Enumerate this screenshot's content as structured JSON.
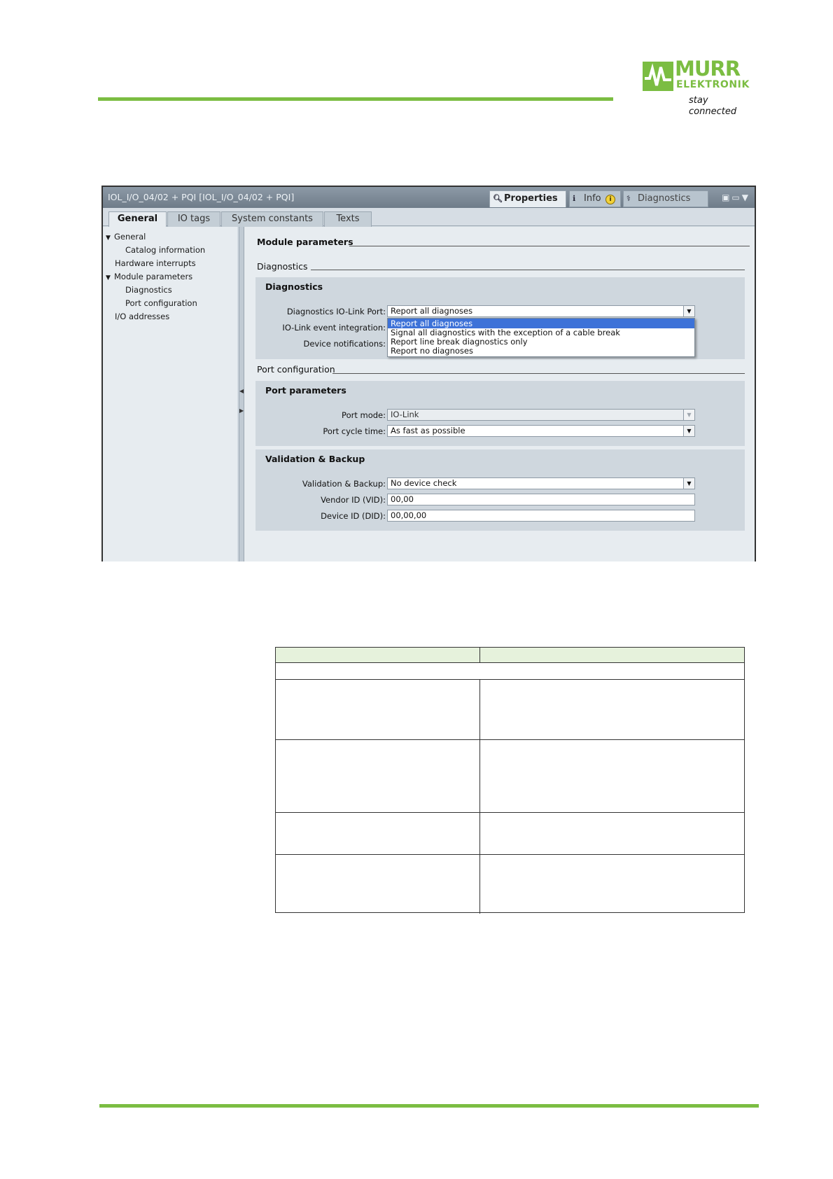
{
  "brand": {
    "name": "MURR",
    "subname": "ELEKTRONIK",
    "tagline": "stay connected",
    "color": "#7bbd42"
  },
  "window": {
    "title": "IOL_I/O_04/02 + PQI [IOL_I/O_04/02 + PQI]",
    "right_tabs": {
      "properties": "Properties",
      "info": "Info",
      "info_badge": "i",
      "diagnostics": "Diagnostics"
    },
    "tabs": [
      "General",
      "IO tags",
      "System constants",
      "Texts"
    ]
  },
  "tree": {
    "items": [
      "General",
      "Catalog information",
      "Hardware interrupts",
      "Module parameters",
      "Diagnostics",
      "Port configuration",
      "I/O addresses"
    ],
    "selected": "Module parameters"
  },
  "content": {
    "heading": "Module parameters",
    "diag_section": "Diagnostics",
    "diag_group": {
      "title": "Diagnostics",
      "labels": {
        "iolink_port": "Diagnostics IO-Link Port:",
        "event_integration": "IO-Link event integration:",
        "device_notifications": "Device notifications:"
      },
      "iolink_port_value": "Report all diagnoses",
      "dropdown_options": [
        "Report all diagnoses",
        "Signal all diagnostics with the exception of a cable break",
        "Report line break diagnostics only",
        "Report no diagnoses"
      ],
      "dropdown_selected": "Report all diagnoses"
    },
    "port_section": "Port configuration",
    "port_group": {
      "title": "Port parameters",
      "labels": {
        "mode": "Port mode:",
        "cycle": "Port cycle time:"
      },
      "mode_value": "IO-Link",
      "cycle_value": "As fast as possible"
    },
    "validation_group": {
      "title": "Validation & Backup",
      "labels": {
        "validation": "Validation & Backup:",
        "vendor": "Vendor ID (VID):",
        "device": "Device ID (DID):"
      },
      "validation_value": "No device check",
      "vendor_value": "00,00",
      "device_value": "00,00,00"
    }
  },
  "table": {
    "header_color": "#e6f2dc"
  }
}
